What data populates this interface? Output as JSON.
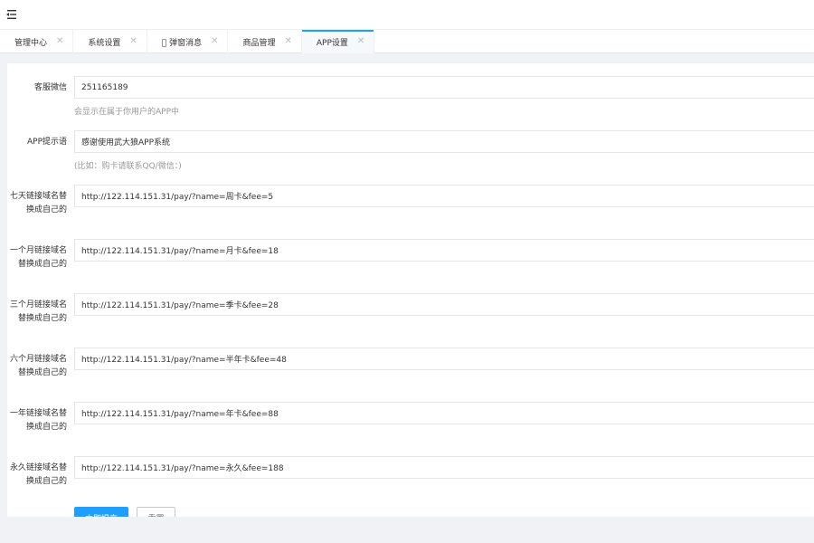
{
  "colors": {
    "accent": "#1e9fff",
    "background": "#f0f2f5"
  },
  "topbar": {
    "menu_icon": "menu-fold-icon"
  },
  "tabs": [
    {
      "label": "管理中心",
      "close": "✕"
    },
    {
      "label": "系统设置",
      "close": "✕"
    },
    {
      "label": "󰃂 弹窗消息",
      "close": "✕"
    },
    {
      "label": "商品管理",
      "close": "✕"
    },
    {
      "label": "APP设置",
      "close": "✕",
      "active": true
    }
  ],
  "form": {
    "wechat": {
      "label": "客服微信",
      "value": "251165189",
      "hint": "会显示在属于你用户的APP中"
    },
    "tip": {
      "label": "APP提示语",
      "value": "感谢使用武大狼APP系统",
      "hint": "(比如：购卡请联系QQ/微信：)"
    },
    "links": [
      {
        "label": "七天链接域名替换成自己的",
        "value": "http://122.114.151.31/pay/?name=周卡&fee=5"
      },
      {
        "label": "一个月链接域名替换成自己的",
        "value": "http://122.114.151.31/pay/?name=月卡&fee=18"
      },
      {
        "label": "三个月链接域名替换成自己的",
        "value": "http://122.114.151.31/pay/?name=季卡&fee=28"
      },
      {
        "label": "六个月链接域名替换成自己的",
        "value": "http://122.114.151.31/pay/?name=半年卡&fee=48"
      },
      {
        "label": "一年链接域名替换成自己的",
        "value": "http://122.114.151.31/pay/?name=年卡&fee=88"
      },
      {
        "label": "永久链接域名替换成自己的",
        "value": "http://122.114.151.31/pay/?name=永久&fee=188"
      }
    ],
    "submit_label": "立即提交",
    "reset_label": "重置"
  }
}
